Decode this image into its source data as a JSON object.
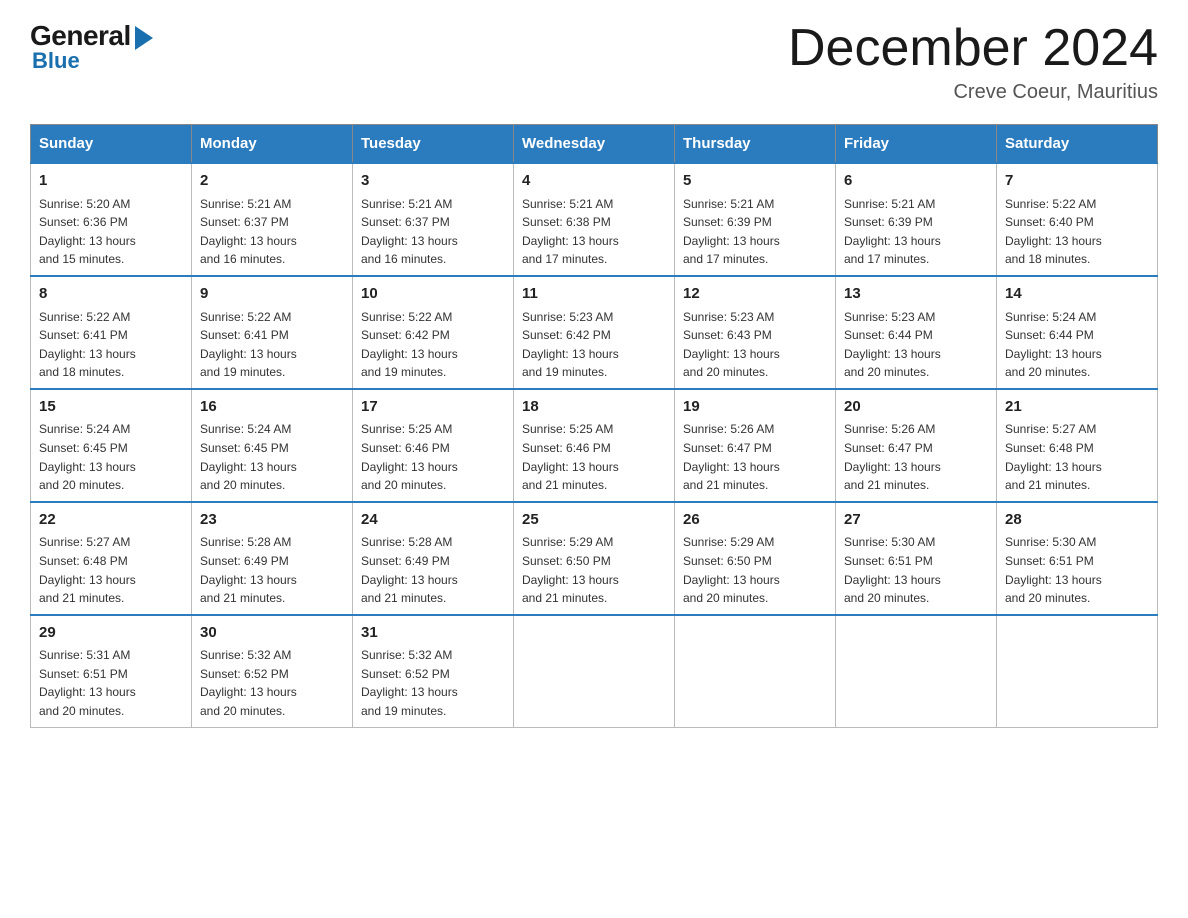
{
  "logo": {
    "general": "General",
    "blue": "Blue"
  },
  "title": "December 2024",
  "location": "Creve Coeur, Mauritius",
  "days_of_week": [
    "Sunday",
    "Monday",
    "Tuesday",
    "Wednesday",
    "Thursday",
    "Friday",
    "Saturday"
  ],
  "weeks": [
    [
      {
        "day": "1",
        "sunrise": "5:20 AM",
        "sunset": "6:36 PM",
        "daylight": "13 hours and 15 minutes."
      },
      {
        "day": "2",
        "sunrise": "5:21 AM",
        "sunset": "6:37 PM",
        "daylight": "13 hours and 16 minutes."
      },
      {
        "day": "3",
        "sunrise": "5:21 AM",
        "sunset": "6:37 PM",
        "daylight": "13 hours and 16 minutes."
      },
      {
        "day": "4",
        "sunrise": "5:21 AM",
        "sunset": "6:38 PM",
        "daylight": "13 hours and 17 minutes."
      },
      {
        "day": "5",
        "sunrise": "5:21 AM",
        "sunset": "6:39 PM",
        "daylight": "13 hours and 17 minutes."
      },
      {
        "day": "6",
        "sunrise": "5:21 AM",
        "sunset": "6:39 PM",
        "daylight": "13 hours and 17 minutes."
      },
      {
        "day": "7",
        "sunrise": "5:22 AM",
        "sunset": "6:40 PM",
        "daylight": "13 hours and 18 minutes."
      }
    ],
    [
      {
        "day": "8",
        "sunrise": "5:22 AM",
        "sunset": "6:41 PM",
        "daylight": "13 hours and 18 minutes."
      },
      {
        "day": "9",
        "sunrise": "5:22 AM",
        "sunset": "6:41 PM",
        "daylight": "13 hours and 19 minutes."
      },
      {
        "day": "10",
        "sunrise": "5:22 AM",
        "sunset": "6:42 PM",
        "daylight": "13 hours and 19 minutes."
      },
      {
        "day": "11",
        "sunrise": "5:23 AM",
        "sunset": "6:42 PM",
        "daylight": "13 hours and 19 minutes."
      },
      {
        "day": "12",
        "sunrise": "5:23 AM",
        "sunset": "6:43 PM",
        "daylight": "13 hours and 20 minutes."
      },
      {
        "day": "13",
        "sunrise": "5:23 AM",
        "sunset": "6:44 PM",
        "daylight": "13 hours and 20 minutes."
      },
      {
        "day": "14",
        "sunrise": "5:24 AM",
        "sunset": "6:44 PM",
        "daylight": "13 hours and 20 minutes."
      }
    ],
    [
      {
        "day": "15",
        "sunrise": "5:24 AM",
        "sunset": "6:45 PM",
        "daylight": "13 hours and 20 minutes."
      },
      {
        "day": "16",
        "sunrise": "5:24 AM",
        "sunset": "6:45 PM",
        "daylight": "13 hours and 20 minutes."
      },
      {
        "day": "17",
        "sunrise": "5:25 AM",
        "sunset": "6:46 PM",
        "daylight": "13 hours and 20 minutes."
      },
      {
        "day": "18",
        "sunrise": "5:25 AM",
        "sunset": "6:46 PM",
        "daylight": "13 hours and 21 minutes."
      },
      {
        "day": "19",
        "sunrise": "5:26 AM",
        "sunset": "6:47 PM",
        "daylight": "13 hours and 21 minutes."
      },
      {
        "day": "20",
        "sunrise": "5:26 AM",
        "sunset": "6:47 PM",
        "daylight": "13 hours and 21 minutes."
      },
      {
        "day": "21",
        "sunrise": "5:27 AM",
        "sunset": "6:48 PM",
        "daylight": "13 hours and 21 minutes."
      }
    ],
    [
      {
        "day": "22",
        "sunrise": "5:27 AM",
        "sunset": "6:48 PM",
        "daylight": "13 hours and 21 minutes."
      },
      {
        "day": "23",
        "sunrise": "5:28 AM",
        "sunset": "6:49 PM",
        "daylight": "13 hours and 21 minutes."
      },
      {
        "day": "24",
        "sunrise": "5:28 AM",
        "sunset": "6:49 PM",
        "daylight": "13 hours and 21 minutes."
      },
      {
        "day": "25",
        "sunrise": "5:29 AM",
        "sunset": "6:50 PM",
        "daylight": "13 hours and 21 minutes."
      },
      {
        "day": "26",
        "sunrise": "5:29 AM",
        "sunset": "6:50 PM",
        "daylight": "13 hours and 20 minutes."
      },
      {
        "day": "27",
        "sunrise": "5:30 AM",
        "sunset": "6:51 PM",
        "daylight": "13 hours and 20 minutes."
      },
      {
        "day": "28",
        "sunrise": "5:30 AM",
        "sunset": "6:51 PM",
        "daylight": "13 hours and 20 minutes."
      }
    ],
    [
      {
        "day": "29",
        "sunrise": "5:31 AM",
        "sunset": "6:51 PM",
        "daylight": "13 hours and 20 minutes."
      },
      {
        "day": "30",
        "sunrise": "5:32 AM",
        "sunset": "6:52 PM",
        "daylight": "13 hours and 20 minutes."
      },
      {
        "day": "31",
        "sunrise": "5:32 AM",
        "sunset": "6:52 PM",
        "daylight": "13 hours and 19 minutes."
      },
      null,
      null,
      null,
      null
    ]
  ],
  "labels": {
    "sunrise": "Sunrise:",
    "sunset": "Sunset:",
    "daylight": "Daylight:"
  }
}
